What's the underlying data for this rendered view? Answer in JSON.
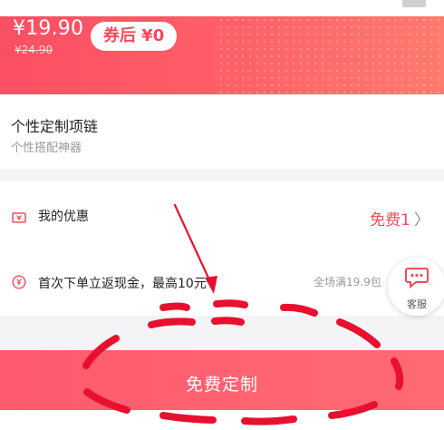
{
  "banner": {
    "price_current": "¥19.90",
    "price_original": "¥24.90",
    "coupon_text": "券后 ¥0"
  },
  "product": {
    "title": "个性定制项链",
    "subtitle": "个性搭配神器"
  },
  "benefits": {
    "my_benefit_label": "我的优惠",
    "my_benefit_value": "免费1",
    "cashback_label": "首次下单立返现金，最高10元",
    "fullsite_note": "全场满19.9包"
  },
  "service": {
    "label": "客服"
  },
  "cta": {
    "label": "免费定制"
  },
  "colors": {
    "accent": "#f04b5b",
    "banner_gradient_start": "#fb4f63",
    "banner_gradient_end": "#ff7a6f",
    "annotation": "#e8102e"
  },
  "icons": {
    "benefit": "ticket-icon",
    "cashback": "yen-circle-icon",
    "service": "chat-bubble-icon"
  }
}
